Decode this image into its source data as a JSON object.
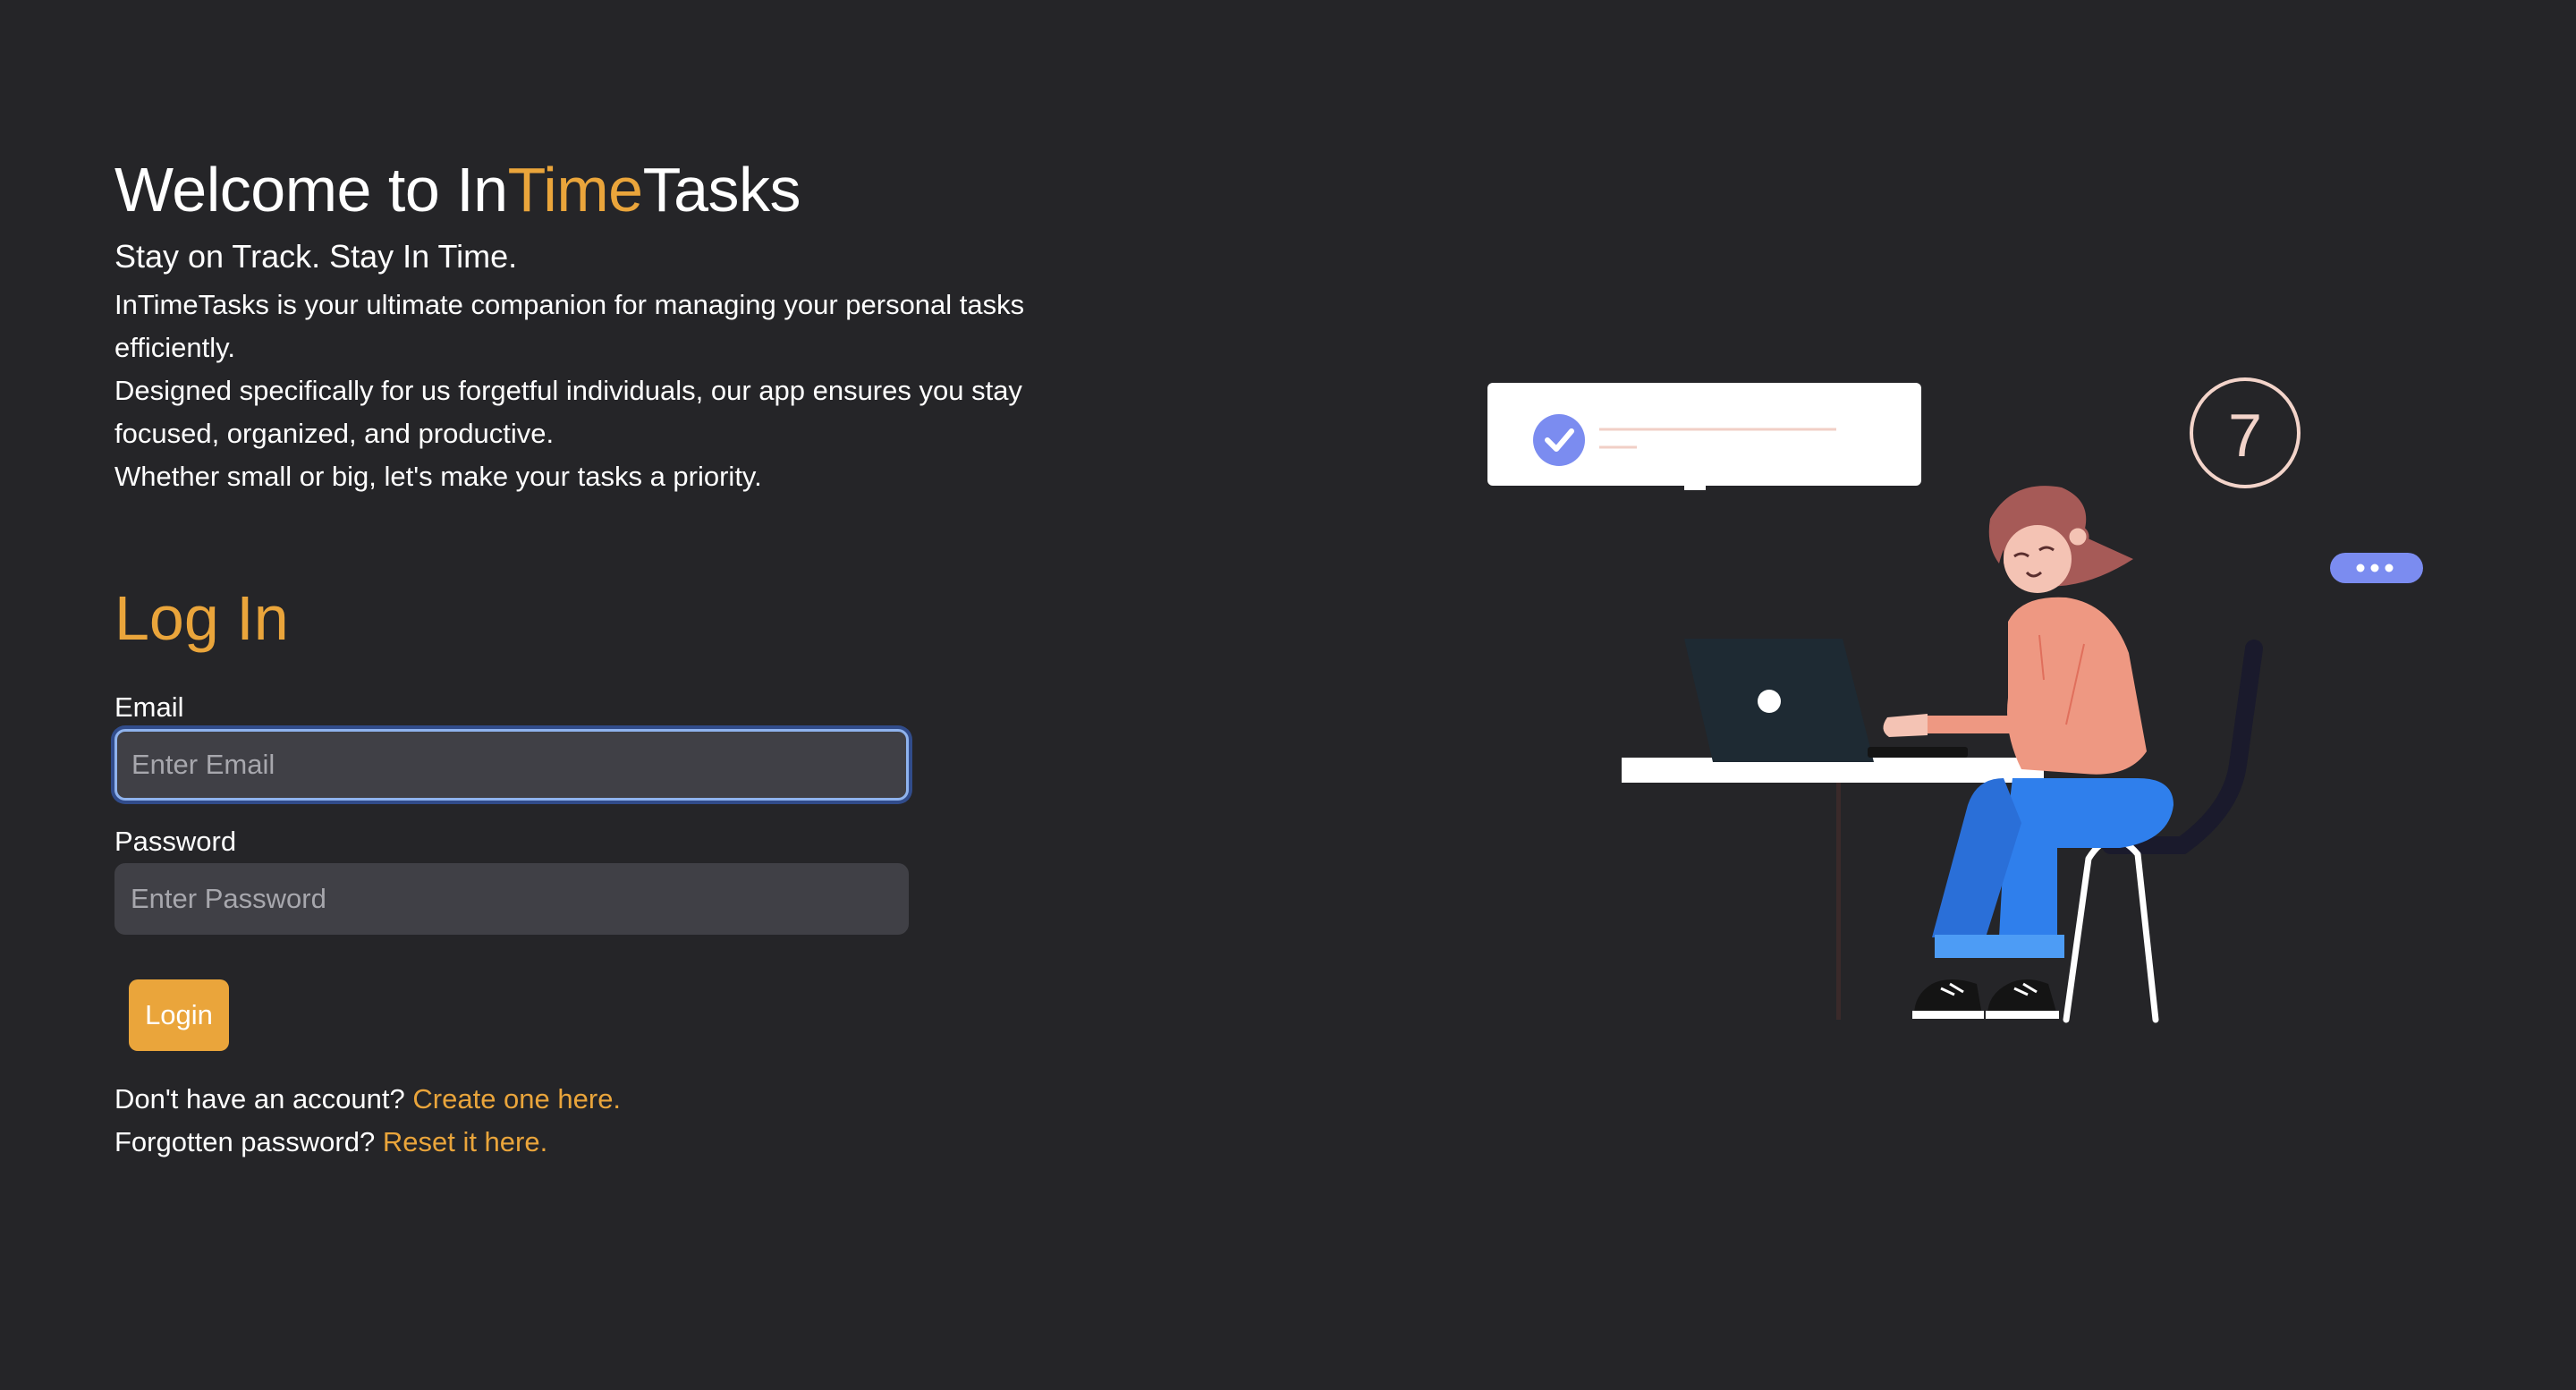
{
  "hero": {
    "title_prefix": "Welcome to In",
    "title_accent": "Time",
    "title_suffix": "Tasks",
    "tagline": "Stay on Track. Stay In Time.",
    "description_lines": [
      "InTimeTasks is your ultimate companion for managing your personal tasks efficiently.",
      "Designed specifically for us forgetful individuals, our app ensures you stay focused, organized, and productive.",
      "Whether small or big, let's make your tasks a priority."
    ]
  },
  "login": {
    "heading": "Log In",
    "email_label": "Email",
    "email_placeholder": "Enter Email",
    "email_value": "",
    "password_label": "Password",
    "password_placeholder": "Enter Password",
    "password_value": "",
    "submit_label": "Login"
  },
  "links": {
    "signup_prompt": "Don't have an account?",
    "signup_link": "Create one here.",
    "reset_prompt": "Forgotten password?",
    "reset_link": "Reset it here."
  },
  "illustration": {
    "clock_hour_numeral": "7",
    "icons": [
      "check-circle-icon",
      "clock-icon",
      "chat-bubble-icon",
      "laptop-icon"
    ]
  },
  "colors": {
    "background": "#252528",
    "accent": "#eaa53b",
    "input_background": "#404046",
    "focus_ring": "#8fb3ee",
    "illustration_purple": "#7b8cf0",
    "illustration_blue": "#2f7fec",
    "illustration_salmon": "#ee9882"
  }
}
